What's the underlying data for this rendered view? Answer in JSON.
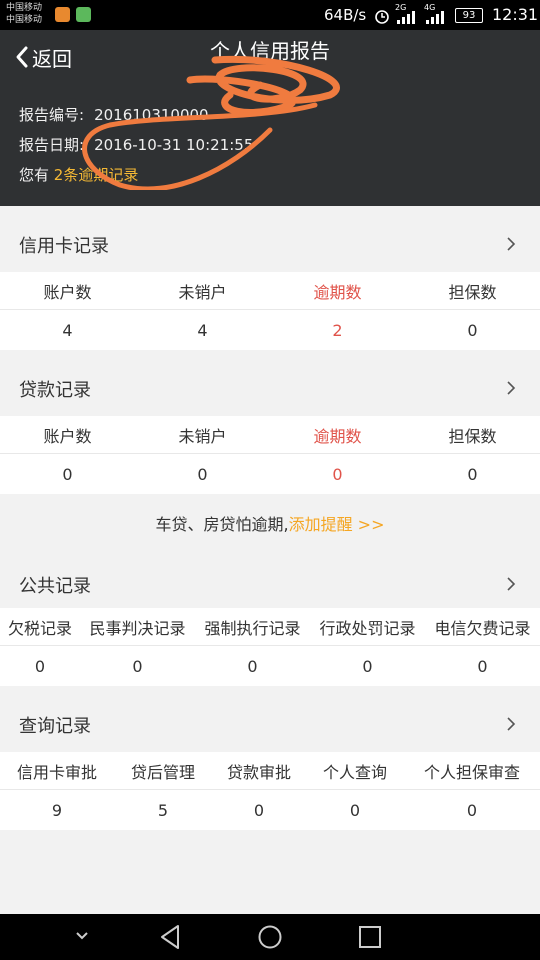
{
  "status_bar": {
    "carrier1": "中国移动",
    "carrier2": "中国移动",
    "speed": "64B/s",
    "network_2g": "2G",
    "network_4g": "4G",
    "battery": "93",
    "time": "12:31"
  },
  "header": {
    "back_label": "返回",
    "title": "个人信用报告",
    "report_no_label": "报告编号:",
    "report_no": "201610310000",
    "report_date_label": "报告日期:",
    "report_date": "2016-10-31 10:21:55",
    "overdue_prefix": "您有",
    "overdue_link": "2条逾期记录"
  },
  "credit_card": {
    "title": "信用卡记录",
    "headers": [
      "账户数",
      "未销户",
      "逾期数",
      "担保数"
    ],
    "values": [
      "4",
      "4",
      "2",
      "0"
    ]
  },
  "loan": {
    "title": "贷款记录",
    "headers": [
      "账户数",
      "未销户",
      "逾期数",
      "担保数"
    ],
    "values": [
      "0",
      "0",
      "0",
      "0"
    ]
  },
  "reminder": {
    "text": "车贷、房贷怕逾期,",
    "link": "添加提醒 >>"
  },
  "public": {
    "title": "公共记录",
    "headers": [
      "欠税记录",
      "民事判决记录",
      "强制执行记录",
      "行政处罚记录",
      "电信欠费记录"
    ],
    "values": [
      "0",
      "0",
      "0",
      "0",
      "0"
    ]
  },
  "query": {
    "title": "查询记录",
    "headers": [
      "信用卡审批",
      "贷后管理",
      "贷款审批",
      "个人查询",
      "个人担保审查"
    ],
    "values": [
      "9",
      "5",
      "0",
      "0",
      "0"
    ]
  },
  "colors": {
    "header_bg": "#2f3133",
    "accent": "#f5b935",
    "overdue_red": "#e0534a"
  }
}
